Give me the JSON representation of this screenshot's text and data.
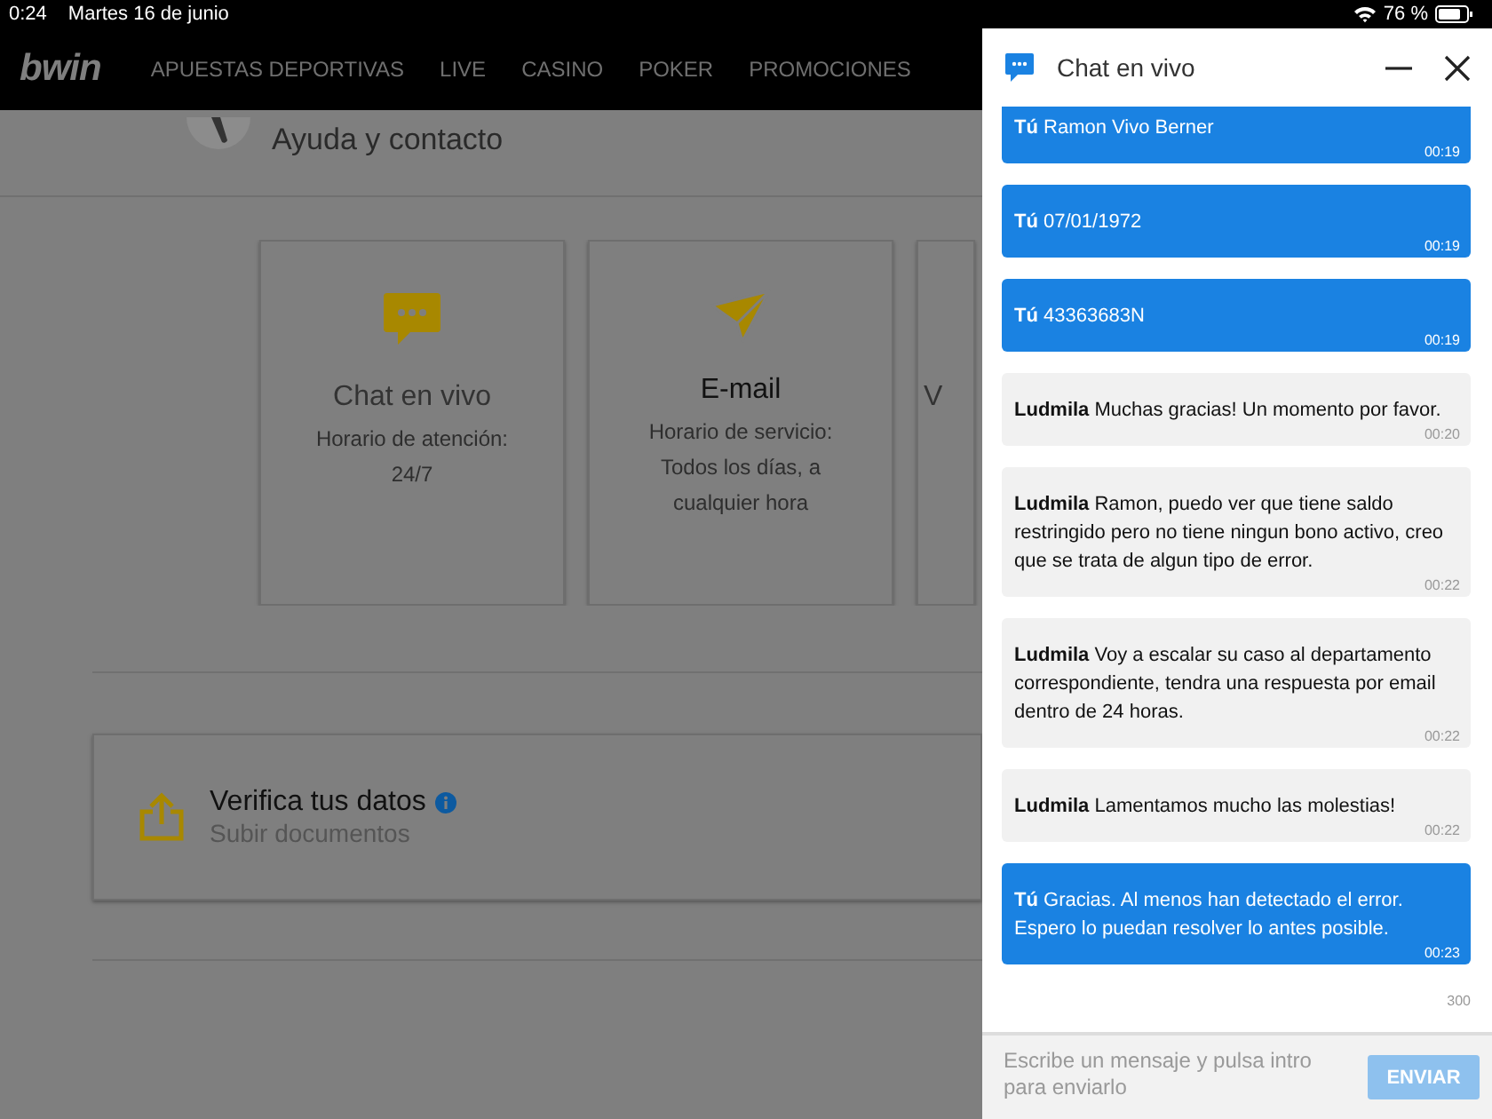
{
  "status_bar": {
    "time": "0:24",
    "date": "Martes 16 de junio",
    "battery": "76 %"
  },
  "nav": {
    "logo": "bwin",
    "items": [
      "APUESTAS DEPORTIVAS",
      "LIVE",
      "CASINO",
      "POKER",
      "PROMOCIONES"
    ]
  },
  "page": {
    "title": "Ayuda y contacto",
    "cards": [
      {
        "title": "Chat en vivo",
        "text": "Horario de atención: 24/7"
      },
      {
        "title": "E-mail",
        "text": "Horario de servicio: Todos los días, a cualquier hora"
      },
      {
        "title": "V"
      }
    ],
    "verify": {
      "title": "Verifica tus datos",
      "subtitle": "Subir documentos"
    }
  },
  "chat": {
    "title": "Chat en vivo",
    "messages": [
      {
        "kind": "me",
        "sender": "Tú",
        "text": "Ramon Vivo Berner",
        "time": "00:19"
      },
      {
        "kind": "me",
        "sender": "Tú",
        "text": "07/01/1972",
        "time": "00:19"
      },
      {
        "kind": "me",
        "sender": "Tú",
        "text": "43363683N",
        "time": "00:19"
      },
      {
        "kind": "agent",
        "sender": "Ludmila",
        "text": "Muchas gracias! Un momento por favor.",
        "time": "00:20"
      },
      {
        "kind": "agent",
        "sender": "Ludmila",
        "text": "Ramon, puedo ver que tiene saldo restringido pero no tiene ningun bono activo, creo que se trata de algun tipo de error.",
        "time": "00:22"
      },
      {
        "kind": "agent",
        "sender": "Ludmila",
        "text": "Voy a escalar su caso al departamento correspondiente, tendra una respuesta por email dentro de 24 horas.",
        "time": "00:22"
      },
      {
        "kind": "agent",
        "sender": "Ludmila",
        "text": "Lamentamos mucho las molestias!",
        "time": "00:22"
      },
      {
        "kind": "me",
        "sender": "Tú",
        "text": "Gracias. Al menos han detectado el error. Espero lo puedan resolver lo antes posible.",
        "time": "00:23"
      }
    ],
    "counter": "300",
    "input": {
      "placeholder": "Escribe un mensaje y pulsa intro para enviarlo"
    },
    "send_button": {
      "label": "ENVIAR",
      "disabled": true
    }
  }
}
